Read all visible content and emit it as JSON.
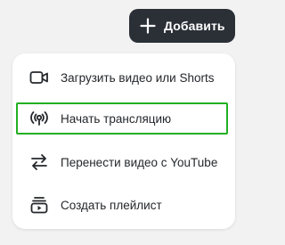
{
  "header": {
    "add_button": {
      "label": "Добавить",
      "icon": "plus-icon"
    }
  },
  "menu": {
    "items": [
      {
        "label": "Загрузить видео или Shorts",
        "icon": "video-camera-icon"
      },
      {
        "label": "Начать трансляцию",
        "icon": "broadcast-icon",
        "highlighted": true
      },
      {
        "label": "Перенести видео с YouTube",
        "icon": "transfer-arrows-icon"
      },
      {
        "label": "Создать плейлист",
        "icon": "playlist-icon"
      }
    ]
  },
  "colors": {
    "background": "#f2f2f2",
    "button_bg": "#2b2f36",
    "menu_bg": "#ffffff",
    "highlight_border": "#22b022",
    "text": "#24272b"
  }
}
